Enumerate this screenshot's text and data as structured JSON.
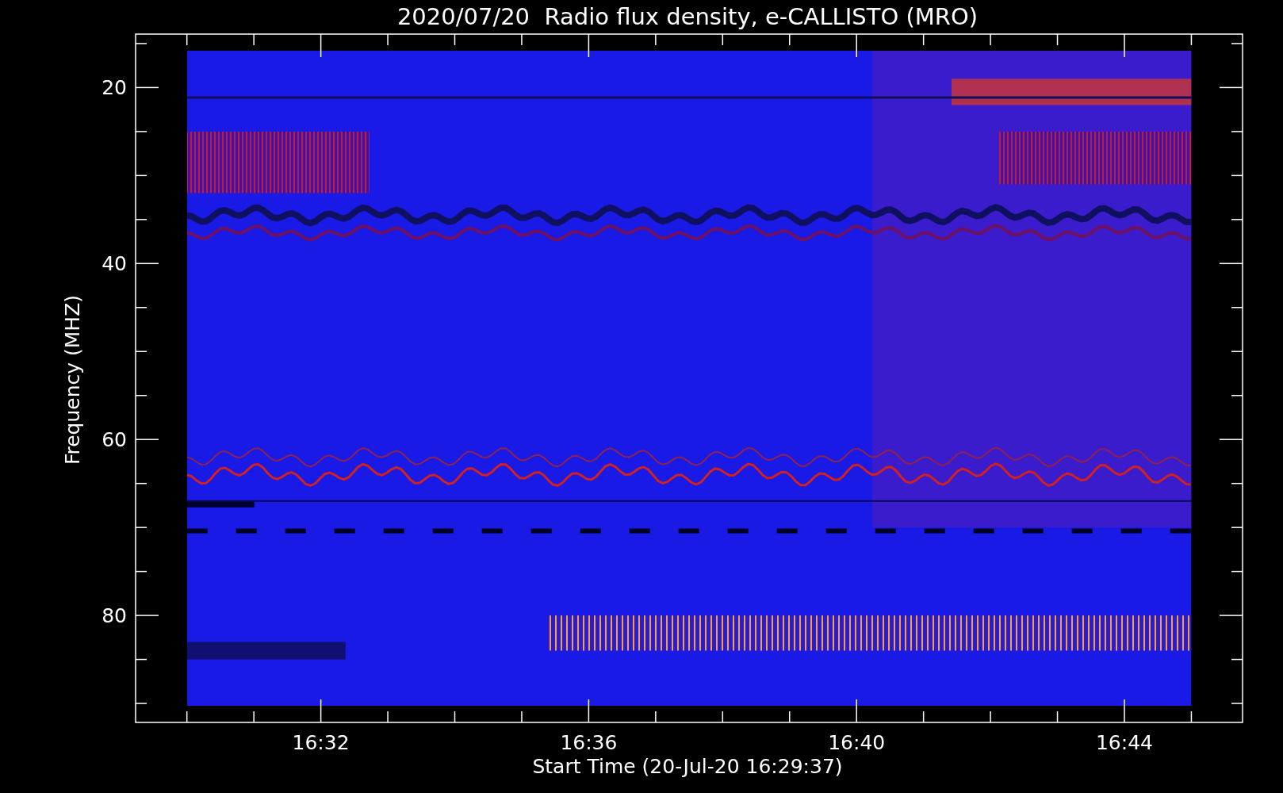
{
  "title": "2020/07/20  Radio flux density, e-CALLISTO (MRO)",
  "y_axis": {
    "label": "Frequency (MHZ)",
    "ticks": [
      "20",
      "40",
      "60",
      "80"
    ]
  },
  "x_axis": {
    "label": "Start Time (20-Jul-20 16:29:37)",
    "ticks": [
      "16:32",
      "16:36",
      "16:40",
      "16:44"
    ]
  }
}
